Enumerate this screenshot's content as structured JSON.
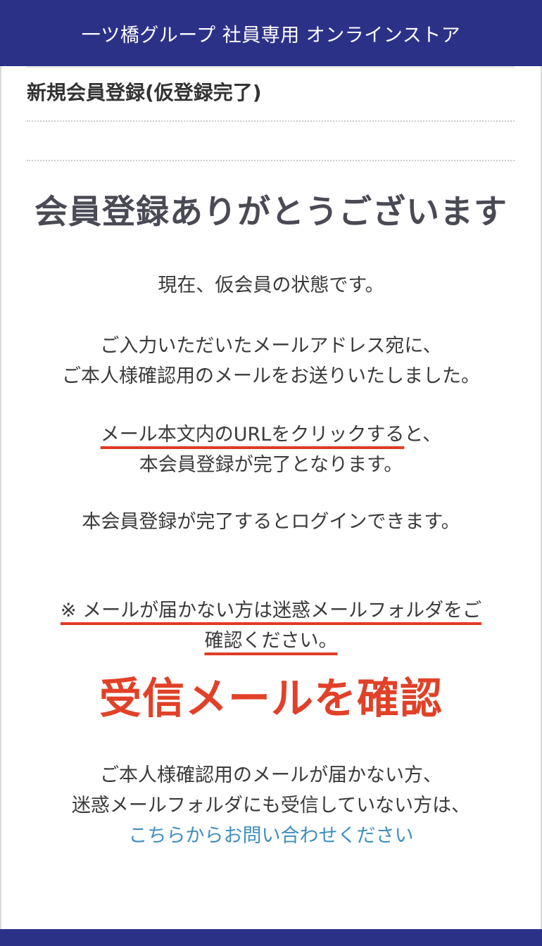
{
  "header": {
    "title": "一ツ橋グループ 社員専用 オンラインストア"
  },
  "section": {
    "title": "新規会員登録(仮登録完了)"
  },
  "main": {
    "thanks": "会員登録ありがとうございます",
    "status": "現在、仮会員の状態です。",
    "sent_line1": "ご入力いただいたメールアドレス宛に、",
    "sent_line2": "ご本人様確認用のメールをお送りいたしました。",
    "url_line1_highlight": "メール本文内のURLをクリックする",
    "url_line1_rest": "と、",
    "url_line2": "本会員登録が完了となります。",
    "login_note": "本会員登録が完了するとログインできます。",
    "warning_line1": "※ メールが届かない方は迷惑メールフォルダをご",
    "warning_line2": "確認ください。",
    "check_inbox": "受信メールを確認",
    "contact_line1": "ご本人様確認用のメールが届かない方、",
    "contact_line2": "迷惑メールフォルダにも受信していない方は、",
    "contact_link": "こちらからお問い合わせください"
  },
  "colors": {
    "header_bg": "#2c3188",
    "accent_red": "#e14128",
    "link_blue": "#3f8fbe"
  }
}
